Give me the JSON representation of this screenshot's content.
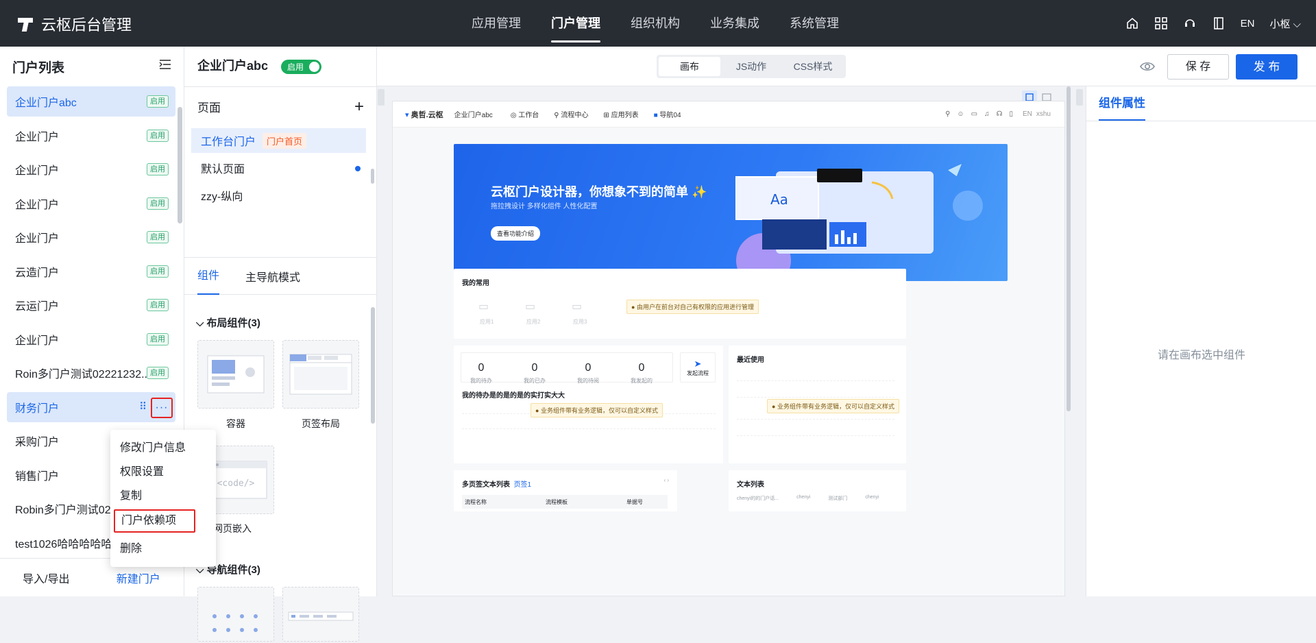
{
  "app": {
    "title": "云枢后台管理"
  },
  "topnav": [
    "应用管理",
    "门户管理",
    "组织机构",
    "业务集成",
    "系统管理"
  ],
  "topnav_active": 1,
  "topright": {
    "lang": "EN",
    "user": "小枢"
  },
  "left_panel": {
    "title": "门户列表",
    "items": [
      {
        "name": "企业门户abc",
        "status": "启用"
      },
      {
        "name": "企业门户",
        "status": "启用"
      },
      {
        "name": "企业门户",
        "status": "启用"
      },
      {
        "name": "企业门户",
        "status": "启用"
      },
      {
        "name": "企业门户",
        "status": "启用"
      },
      {
        "name": "云造门户",
        "status": "启用"
      },
      {
        "name": "云运门户",
        "status": "启用"
      },
      {
        "name": "企业门户",
        "status": "启用"
      },
      {
        "name": "Roin多门户测试02221232...",
        "status": "启用"
      },
      {
        "name": "财务门户",
        "status": ""
      },
      {
        "name": "采购门户",
        "status": ""
      },
      {
        "name": "销售门户",
        "status": ""
      },
      {
        "name": "Robin多门户测试02",
        "status": ""
      },
      {
        "name": "test1026哈哈哈哈哈",
        "status": ""
      }
    ],
    "footer": {
      "export": "导入/导出",
      "create": "新建门户"
    }
  },
  "context_menu": [
    "修改门户信息",
    "权限设置",
    "复制",
    "门户依赖项",
    "删除"
  ],
  "portal_header": {
    "name": "企业门户abc",
    "toggle_label": "启用"
  },
  "pages": {
    "title": "页面",
    "list": [
      {
        "name": "工作台门户",
        "tag": "门户首页"
      },
      {
        "name": "默认页面",
        "tag": ""
      },
      {
        "name": "zzy-纵向",
        "tag": ""
      }
    ]
  },
  "component_tabs": [
    "组件",
    "主导航模式"
  ],
  "groups": [
    {
      "title": "布局组件(3)",
      "items": [
        "容器",
        "页签布局",
        "网页嵌入"
      ]
    },
    {
      "title": "导航组件(3)"
    }
  ],
  "code_placeholder": "<code/>",
  "toolbar": {
    "modes": [
      "画布",
      "JS动作",
      "CSS样式"
    ],
    "save": "保 存",
    "publish": "发 布"
  },
  "right_panel": {
    "tab": "组件属性",
    "empty": "请在画布选中组件"
  },
  "preview": {
    "logo": "奥哲.云枢",
    "portal": "企业门户abc",
    "nav": [
      "工作台",
      "流程中心",
      "应用列表",
      "导航04"
    ],
    "lang": "EN",
    "user": "xshu",
    "banner_title": "云枢门户设计器，你想象不到的简单 ✨",
    "banner_sub": "拖拉拽设计  多样化组件  人性化配置",
    "banner_btn": "查看功能介绍",
    "common": {
      "title": "我的常用",
      "apps": [
        "应用1",
        "应用2",
        "应用3"
      ],
      "note": "由用户在前台对自己有权限的应用进行管理"
    },
    "stats": [
      {
        "n": "0",
        "l": "我的待办"
      },
      {
        "n": "0",
        "l": "我的已办"
      },
      {
        "n": "0",
        "l": "我的待阅"
      },
      {
        "n": "0",
        "l": "我发起的"
      }
    ],
    "start_flow": "发起流程",
    "todo_title": "我的待办是的是的是的实打实大大",
    "biz_note": "业务组件带有业务逻辑，仅可以自定义样式",
    "recent_title": "最近使用",
    "multi_title": "多页签文本列表",
    "multi_tab": "页签1",
    "cols": [
      "流程名称",
      "流程模板",
      "单据号"
    ],
    "text_list_title": "文本列表",
    "text_list_row": [
      "chenyi的的门户话...",
      "chenyi",
      "测试部门",
      "chenyi"
    ]
  }
}
